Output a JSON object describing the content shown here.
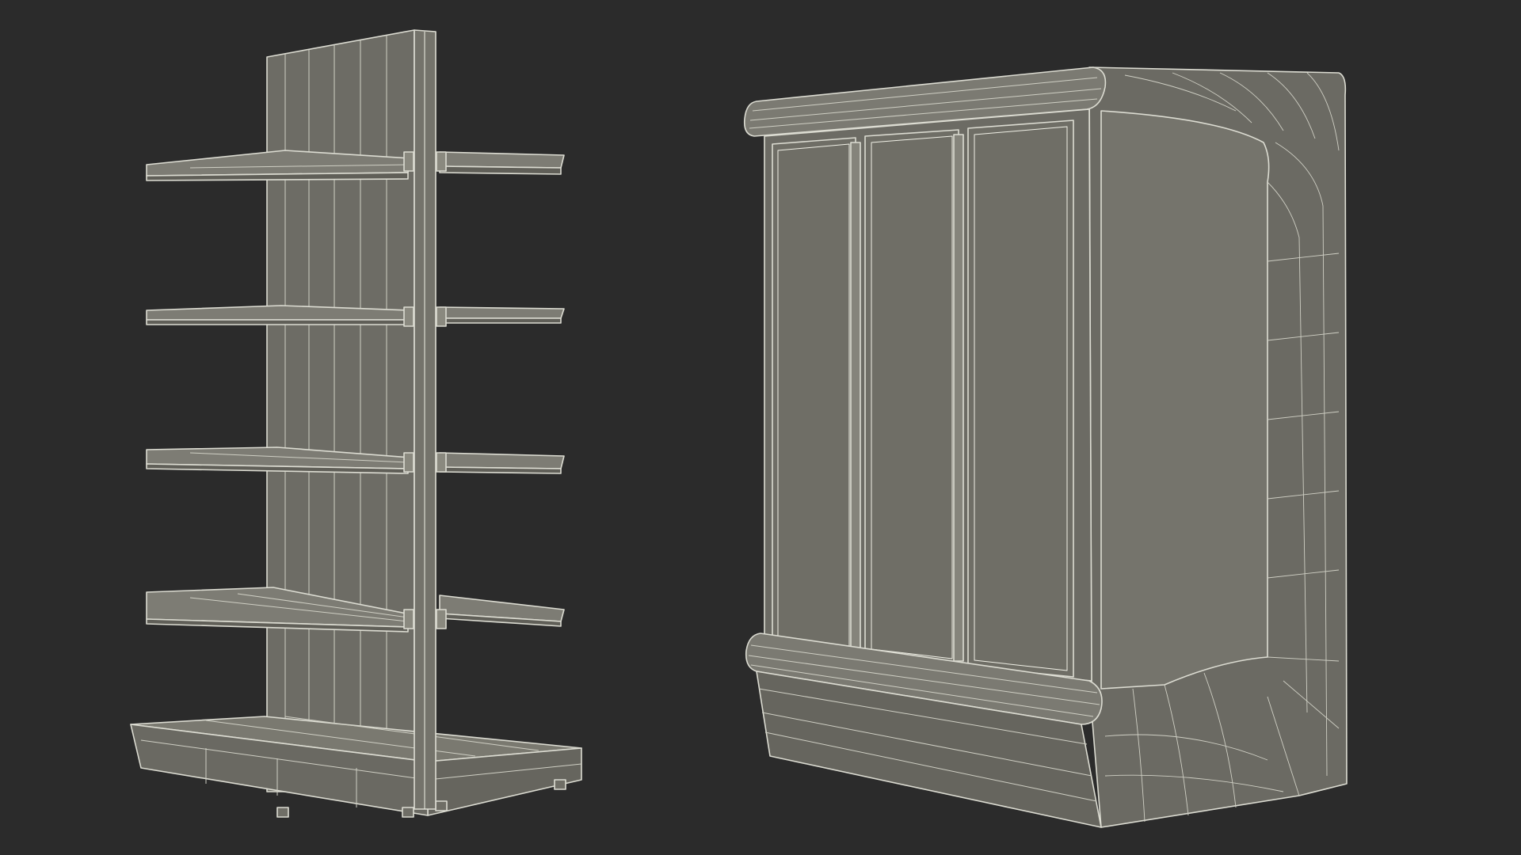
{
  "colors": {
    "background": "#2b2b2b",
    "model_fill": "#6f6e66",
    "model_fill_dark": "#5f5e57",
    "model_fill_light": "#7b7a72",
    "wire": "#dcdcd2",
    "wire_strong": "#f0f0e6"
  },
  "objects": {
    "shelf_unit": {},
    "display_fridge": {}
  }
}
